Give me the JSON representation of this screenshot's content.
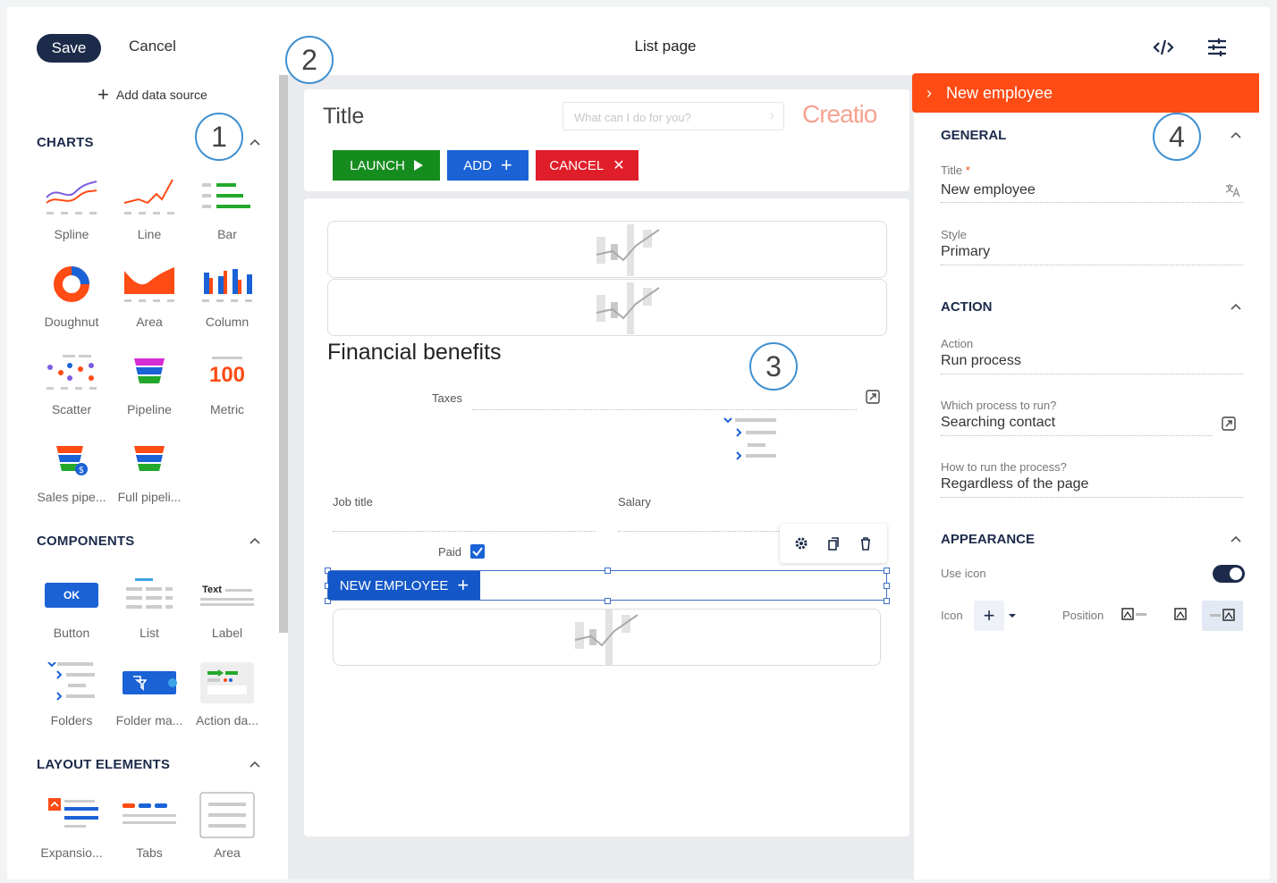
{
  "topbar": {
    "save_label": "Save",
    "cancel_label": "Cancel",
    "title": "List page"
  },
  "callouts": [
    "1",
    "2",
    "3",
    "4"
  ],
  "left": {
    "add_data_source": "Add data source",
    "charts_title": "CHARTS",
    "charts": [
      "Spline",
      "Line",
      "Bar",
      "Doughnut",
      "Area",
      "Column",
      "Scatter",
      "Pipeline",
      "Metric",
      "Sales pipe...",
      "Full pipeli..."
    ],
    "metric_value": "100",
    "components_title": "COMPONENTS",
    "components": [
      "Button",
      "List",
      "Label",
      "Folders",
      "Folder ma...",
      "Action da..."
    ],
    "button_icon_text": "OK",
    "label_icon_text": "Text",
    "layout_title": "LAYOUT ELEMENTS",
    "layout": [
      "Expansio...",
      "Tabs",
      "Area"
    ]
  },
  "canvas": {
    "title": "Title",
    "search_placeholder": "What can I do for you?",
    "logo": "Creatio",
    "launch": "LAUNCH",
    "add": "ADD",
    "cancel": "CANCEL",
    "section_title": "Financial benefits",
    "taxes": "Taxes",
    "job_title": "Job title",
    "salary": "Salary",
    "paid": "Paid",
    "new_employee": "NEW EMPLOYEE"
  },
  "right": {
    "header": "New employee",
    "general": "GENERAL",
    "title_label": "Title",
    "title_required": "*",
    "title_value": "New employee",
    "style_label": "Style",
    "style_value": "Primary",
    "action_section": "ACTION",
    "action_label": "Action",
    "action_value": "Run process",
    "which_label": "Which process to run?",
    "which_value": "Searching contact",
    "how_label": "How to run the process?",
    "how_value": "Regardless of the page",
    "appearance": "APPEARANCE",
    "use_icon": "Use icon",
    "icon_label": "Icon",
    "position_label": "Position"
  },
  "colors": {
    "accent": "#ff4b14",
    "navy": "#1c2b4a",
    "launch": "#168c1e",
    "add": "#1a62d6",
    "cancel": "#e01e2a",
    "callout": "#3e8fd0"
  }
}
